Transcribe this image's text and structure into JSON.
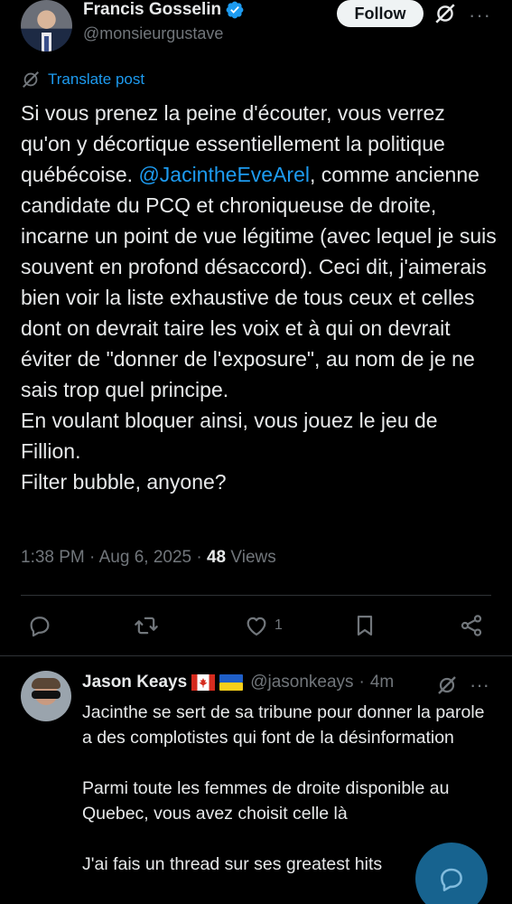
{
  "author": {
    "display_name": "Francis Gosselin",
    "handle": "@monsieurgustave",
    "follow_label": "Follow"
  },
  "translate_label": "Translate post",
  "post": {
    "text_before_mention": "Si vous prenez la peine d'écouter, vous verrez qu'on y décortique essentiellement la politique québécoise. ",
    "mention": "@JacintheEveArel",
    "text_after_mention": ", comme ancienne candidate du PCQ et chroniqueuse de droite, incarne un point de vue légitime (avec lequel je suis souvent en profond désaccord). Ceci dit, j'aimerais bien voir la liste exhaustive de tous ceux et celles dont on devrait taire les voix et à qui on devrait éviter de \"donner de l'exposure\", au nom de je ne sais trop quel principe.\nEn voulant bloquer ainsi, vous jouez le jeu de Fillion.\nFilter bubble, anyone?",
    "time": "1:38 PM",
    "date": "Aug 6, 2025",
    "views_count": "48",
    "views_label": "Views"
  },
  "actions": {
    "like_count": "1"
  },
  "reply": {
    "display_name": "Jason Keays",
    "handle": "@jasonkeays",
    "age": "4m",
    "text": "Jacinthe se sert de sa tribune pour donner la parole a des complotistes qui font de la désinformation\n\nParmi toute les femmes de droite disponible au Quebec, vous avez choisit celle là\n\nJ'ai fais un thread sur ses greatest hits"
  },
  "colors": {
    "background": "#000000",
    "accent": "#1d9bf0",
    "text": "#e7e9ea",
    "secondary": "#71767b"
  },
  "icons": [
    "verified-badge-icon",
    "grok-icon",
    "more-icon",
    "translate-icon",
    "reply-icon",
    "repost-icon",
    "like-icon",
    "bookmark-icon",
    "share-icon",
    "canada-flag-icon",
    "ukraine-flag-icon",
    "compose-icon"
  ]
}
